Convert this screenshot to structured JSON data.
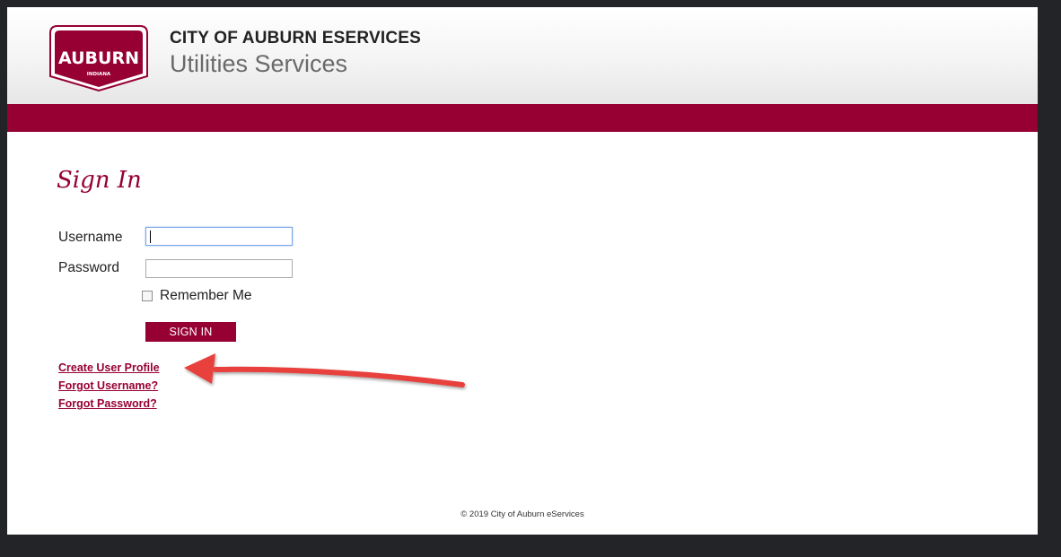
{
  "header": {
    "logo_text": "AUBURN",
    "logo_subtext": "INDIANA",
    "title": "CITY OF AUBURN ESERVICES",
    "subtitle": "Utilities Services"
  },
  "colors": {
    "brand": "#970033",
    "annotation_arrow": "#e8413c"
  },
  "signin": {
    "title": "Sign In",
    "username_label": "Username",
    "username_value": "",
    "password_label": "Password",
    "password_value": "",
    "remember_label": "Remember Me",
    "remember_checked": false,
    "button_label": "SIGN IN"
  },
  "links": {
    "create_profile": "Create User Profile",
    "forgot_username": "Forgot Username?",
    "forgot_password": "Forgot Password?"
  },
  "annotation": {
    "icon": "arrow-left-icon"
  },
  "footer": {
    "copyright": "© 2019 City of Auburn eServices"
  }
}
